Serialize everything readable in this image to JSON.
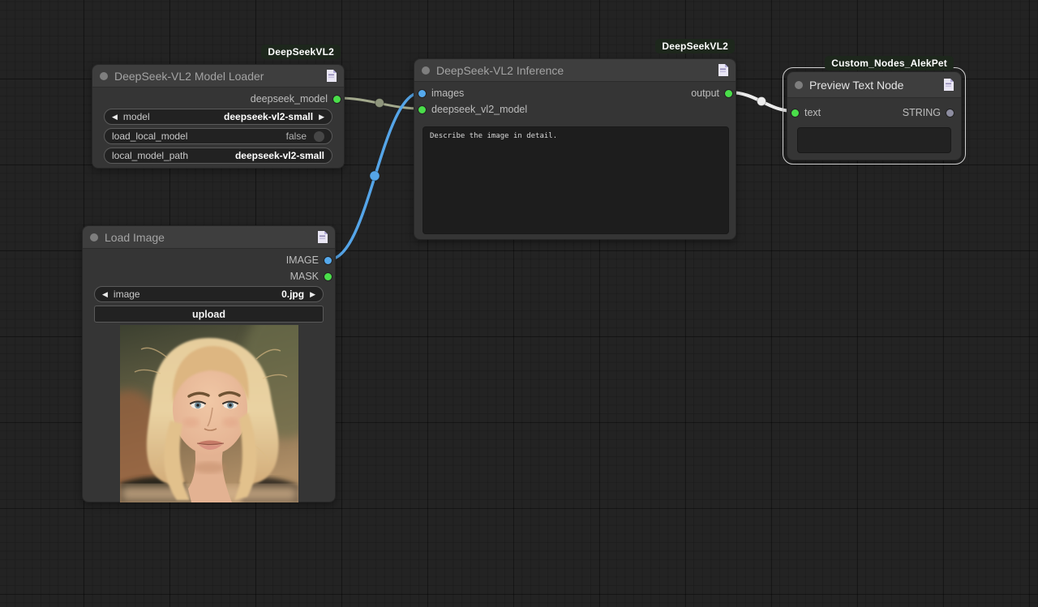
{
  "colors": {
    "canvas-bg": "#232323",
    "node-bg": "#353535",
    "node-header": "#3e3e3e",
    "badge-bg": "#1d271c",
    "badge-text": "#ffffff",
    "port-green": "#4ade4a",
    "port-blue": "#55a9ec",
    "port-gray": "#8d8da0",
    "link-model": "#a3a98d",
    "reroute-model": "#8e957c",
    "link-image": "#55a5e8",
    "link-string": "#ededed",
    "widget-bg": "#222222",
    "widget-border": "#5a5a5a",
    "textarea-bg": "#1d1d1d"
  },
  "icons": {
    "combo-prev": "◀",
    "combo-next": "▶"
  },
  "nodes": {
    "model_loader": {
      "badge": "DeepSeekVL2",
      "title": "DeepSeek-VL2 Model Loader",
      "outputs": [
        {
          "label": "deepseek_model"
        }
      ],
      "widgets": [
        {
          "label": "model",
          "value": "deepseek-vl2-small"
        },
        {
          "label": "load_local_model",
          "value": "false"
        },
        {
          "label": "local_model_path",
          "value": "deepseek-vl2-small"
        }
      ]
    },
    "inference": {
      "badge": "DeepSeekVL2",
      "title": "DeepSeek-VL2 Inference",
      "inputs": [
        {
          "label": "images"
        },
        {
          "label": "deepseek_vl2_model"
        }
      ],
      "outputs": [
        {
          "label": "output"
        }
      ],
      "prompt": "Describe the image in detail."
    },
    "preview_text": {
      "badge": "Custom_Nodes_AlekPet",
      "title": "Preview Text Node",
      "inputs": [
        {
          "label": "text"
        }
      ],
      "outputs": [
        {
          "label": "STRING"
        }
      ],
      "text_value": ""
    },
    "load_image": {
      "title": "Load Image",
      "outputs": [
        {
          "label": "IMAGE"
        },
        {
          "label": "MASK"
        }
      ],
      "widgets": [
        {
          "label": "image",
          "value": "0.jpg"
        }
      ],
      "button_label": "upload"
    }
  }
}
